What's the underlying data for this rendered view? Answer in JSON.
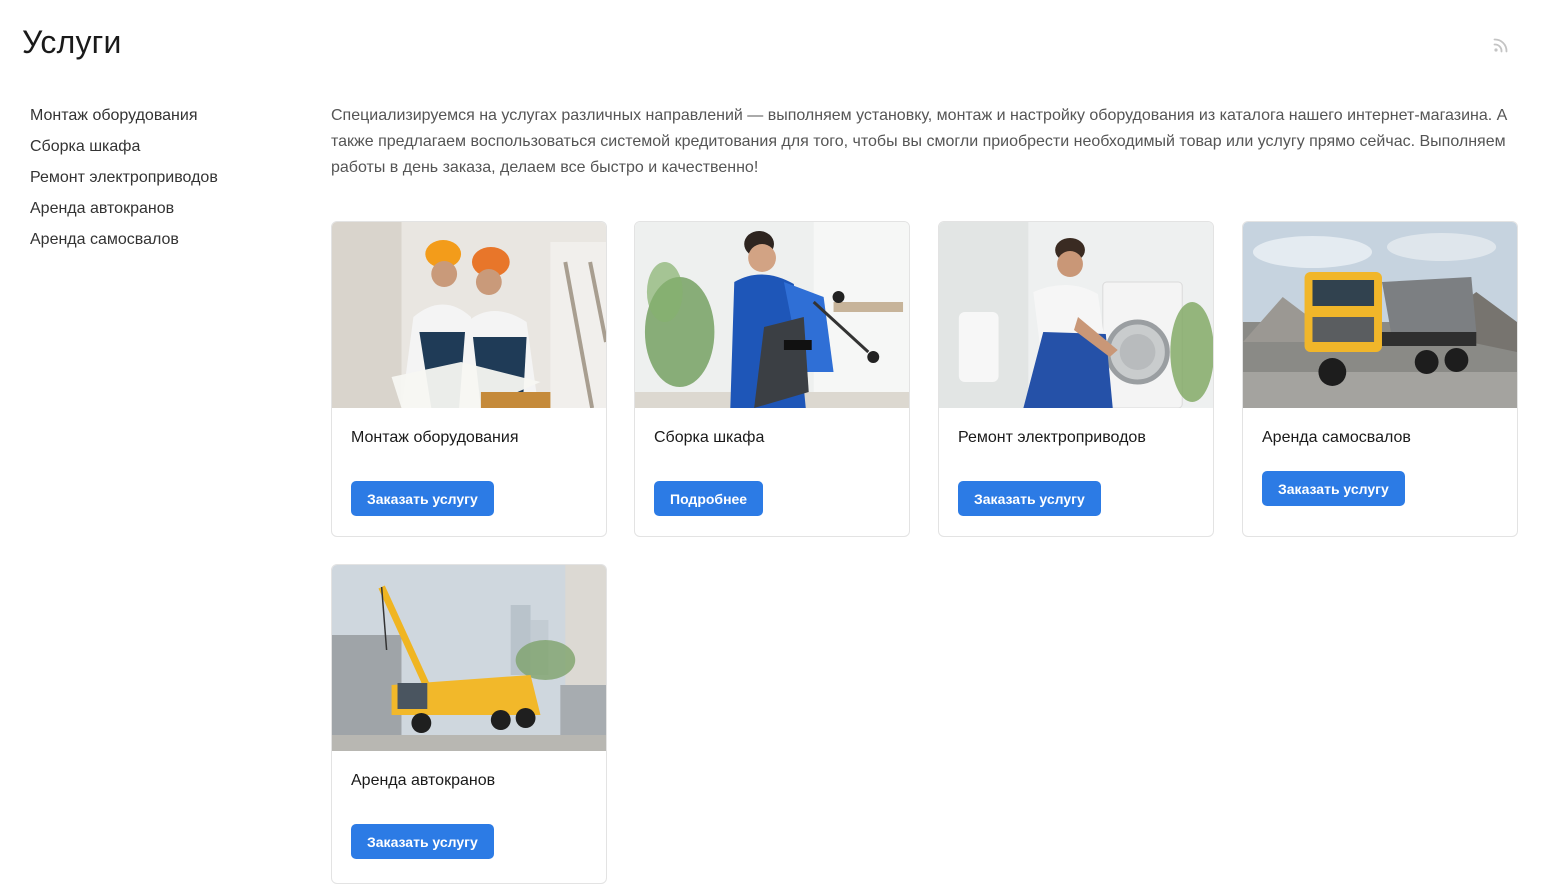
{
  "page": {
    "title": "Услуги",
    "rss_icon": "rss-icon"
  },
  "sidebar": {
    "items": [
      {
        "label": "Монтаж оборудования"
      },
      {
        "label": "Сборка шкафа"
      },
      {
        "label": "Ремонт электроприводов"
      },
      {
        "label": "Аренда автокранов"
      },
      {
        "label": "Аренда самосвалов"
      }
    ]
  },
  "intro": "Специализируемся на услугах различных направлений — выполняем установку, монтаж и настройку оборудования из каталога нашего интернет-магазина. А также предлагаем воспользоваться системой кредитования для того, чтобы вы смогли приобрести необходимый товар или услугу прямо сейчас. Выполняем работы в день заказа, делаем все быстро и качественно!",
  "cards": [
    {
      "title": "Монтаж оборудования",
      "button": "Заказать услугу",
      "image": "workers-with-blueprint-photo"
    },
    {
      "title": "Сборка шкафа",
      "button": "Подробнее",
      "image": "worker-assembling-chair-photo"
    },
    {
      "title": "Ремонт электроприводов",
      "button": "Заказать услугу",
      "image": "worker-repairing-washing-machine-photo"
    },
    {
      "title": "Аренда самосвалов",
      "button": "Заказать услугу",
      "image": "yellow-dump-truck-photo"
    },
    {
      "title": "Аренда автокранов",
      "button": "Заказать услугу",
      "image": "yellow-mobile-crane-photo"
    }
  ],
  "colors": {
    "accent": "#2c7be5",
    "text": "#1a1a1a",
    "muted": "#555555",
    "border": "#e3e3e3"
  }
}
